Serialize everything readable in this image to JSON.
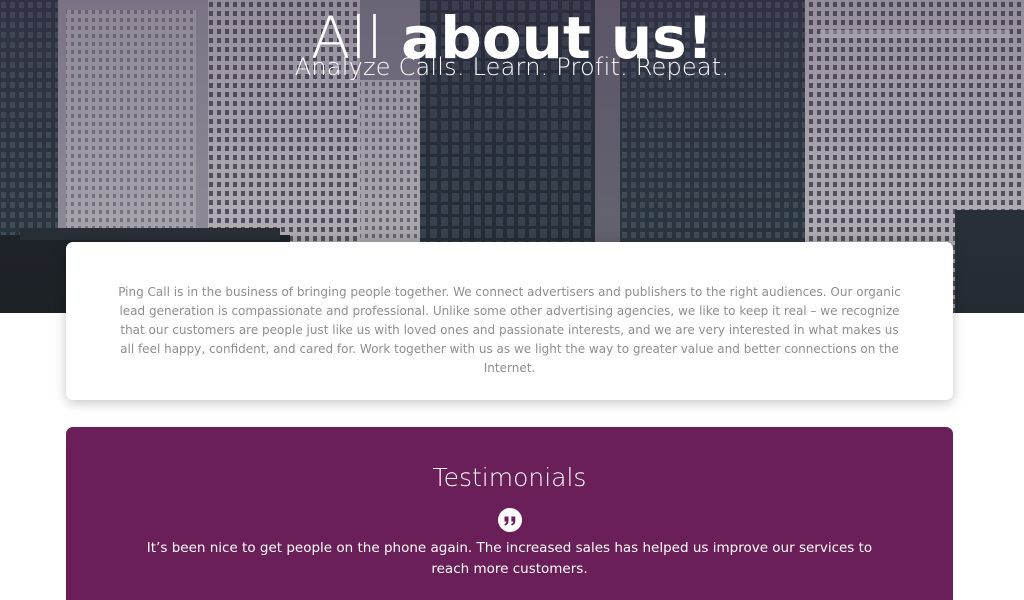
{
  "hero": {
    "title_light": "All ",
    "title_bold": "about us!",
    "subtitle": "Analyze Calls. Learn. Profit. Repeat."
  },
  "about": {
    "text": "Ping Call is in the business of bringing people together. We connect advertisers and publishers to the right audiences. Our organic lead generation is compassionate and professional. Unlike some other advertising agencies, we like to keep it real – we recognize that our customers are people just like us with loved ones and passionate interests, and we are very interested in what makes us all feel happy, confident, and cared for. Work together with us as we light the way to greater value and better connections on the Internet."
  },
  "testimonials": {
    "title": "Testimonials",
    "icon": "quote-icon",
    "quote": "It’s been nice to get people on the phone again. The increased sales has helped us improve our services to reach more customers."
  },
  "colors": {
    "testimonials_background": "#6b1f58",
    "about_text": "#8e8e8e",
    "hero_text": "#ffffff"
  }
}
